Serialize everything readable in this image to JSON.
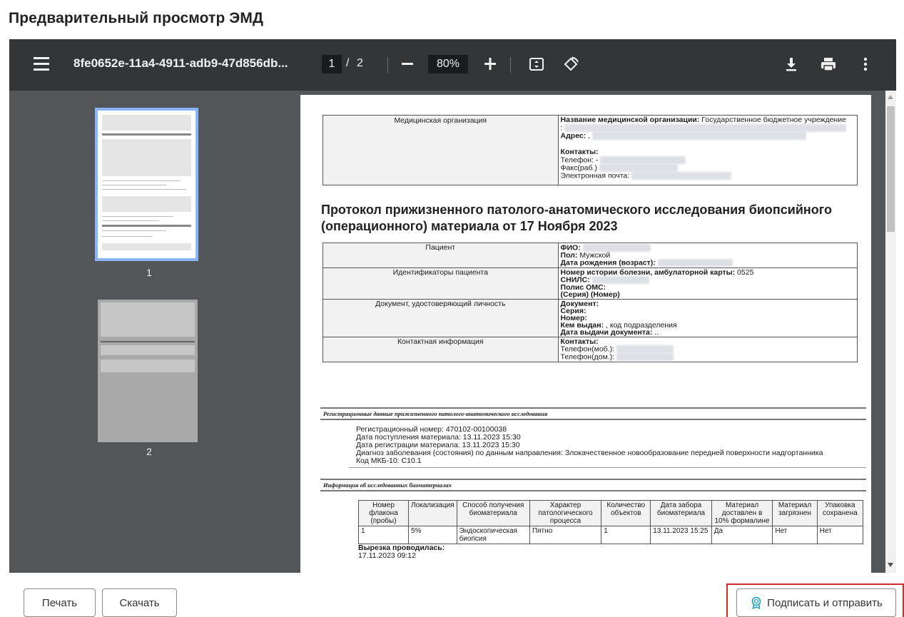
{
  "dialog": {
    "title": "Предварительный просмотр ЭМД"
  },
  "toolbar": {
    "filename": "8fe0652e-11a4-4911-adb9-47d856db...",
    "page_current": "1",
    "page_separator": "/",
    "page_total": "2",
    "zoom": "80%",
    "icons": [
      "menu-icon",
      "zoom-out-icon",
      "zoom-in-icon",
      "fit-page-icon",
      "rotate-icon",
      "download-icon",
      "print-icon",
      "more-icon"
    ]
  },
  "thumbnails": [
    {
      "label": "1",
      "selected": true
    },
    {
      "label": "2",
      "selected": false
    }
  ],
  "document": {
    "org_label": "Медицинская организация",
    "org_name_key": "Название медицинской организации:",
    "org_name_val": "Государственное бюджетное учреждение",
    "org_colon": ":",
    "address_key": "Адрес:",
    "address_val": ",",
    "contacts_key": "Контакты:",
    "phone_key": "Телефон:",
    "phone_val": "-",
    "fax_key": "Факс(раб.)",
    "email_key": "Электронная почта:",
    "title": "Протокол прижизненного патолого-анатомического исследования биопсийного (операционного) материала от 17 Ноября 2023",
    "patient_label": "Пациент",
    "fio_key": "ФИО:",
    "sex_key": "Пол:",
    "sex_val": "Мужской",
    "dob_key": "Дата рождения (возраст):",
    "ids_label": "Идентификаторы пациента",
    "history_key": "Номер истории болезни, амбулаторной карты:",
    "history_val": "0525",
    "snils_key": "СНИЛС:",
    "oms_key": "Полис ОМС:",
    "oms_series": "(Серия) (Номер)",
    "iddoc_label": "Документ, удостоверяющий личность",
    "doc_key": "Документ:",
    "series_key": "Серия:",
    "number_key": "Номер:",
    "issued_key": "Кем выдан:",
    "issued_val": ", код подразделения",
    "issue_date_key": "Дата выдачи документа:",
    "issue_date_val": "..",
    "contact_label": "Контактная информация",
    "contacts2_key": "Контакты:",
    "mob_key": "Телефон(моб.):",
    "home_key": "Телефон(дом.):",
    "reg_section": "Регистрационные данные прижизненного патолого-анатомического исследования",
    "reg_number": "Регистрационный номер: 470102-00100038",
    "reg_received": "Дата поступления материала: 13.11.2023 15:30",
    "reg_registered": "Дата регистрации материала: 13.11.2023 15:30",
    "reg_diagnosis": "Диагноз заболевания (состояния) по данным направления: Злокачественное новообразование передней поверхности надгортанника",
    "reg_mkb": "Код МКБ-10: C10.1",
    "bio_section": "Информация об исследованных биоматериалах",
    "bio_headers": [
      "Номер флакона (пробы)",
      "Локализация",
      "Способ получения биоматериала",
      "Характер патологического процесса",
      "Количество объектов",
      "Дата забора биоматериала",
      "Материал доставлен в 10% формалине",
      "Материал загрязнен",
      "Упаковка сохранена"
    ],
    "bio_row": [
      "1",
      "5%",
      "Эндоскопическая биопсия",
      "Пятно",
      "1",
      "13.11.2023 15:25",
      "Да",
      "Нет",
      "Нет"
    ],
    "cut_key": "Вырезка проводилась:",
    "cut_val": "17.11.2023 09:12"
  },
  "footer": {
    "print_label": "Печать",
    "download_label": "Скачать",
    "sign_label": "Подписать и отправить"
  },
  "colors": {
    "toolbar_bg": "#323639",
    "viewer_bg": "#525659",
    "highlight": "#d42a2a",
    "thumb_selected": "#8ab4f8"
  }
}
